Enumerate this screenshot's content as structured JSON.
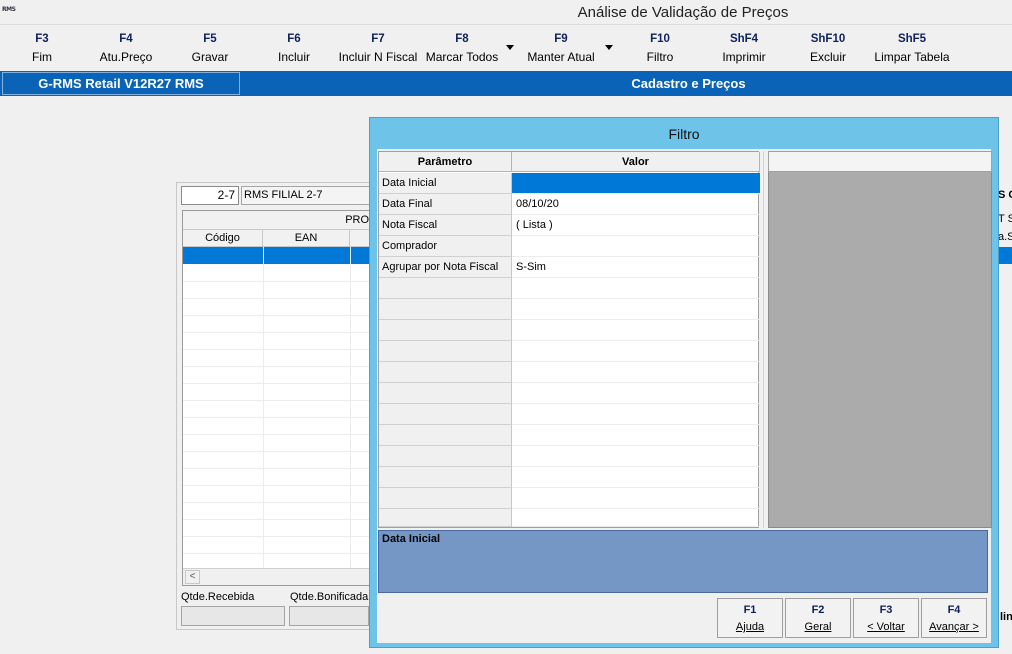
{
  "window": {
    "title": "Análise de Validação de Preços",
    "logo_text": "RMS"
  },
  "toolbar": [
    {
      "key": "F3",
      "label": "Fim"
    },
    {
      "key": "F4",
      "label": "Atu.Preço"
    },
    {
      "key": "F5",
      "label": "Gravar"
    },
    {
      "key": "F6",
      "label": "Incluir"
    },
    {
      "key": "F7",
      "label": "Incluir N Fiscal"
    },
    {
      "key": "F8",
      "label": "Marcar Todos"
    },
    {
      "key": "F9",
      "label": "Manter Atual"
    },
    {
      "key": "F10",
      "label": "Filtro"
    },
    {
      "key": "ShF4",
      "label": "Imprimir"
    },
    {
      "key": "ShF10",
      "label": "Excluir"
    },
    {
      "key": "ShF5",
      "label": "Limpar Tabela"
    }
  ],
  "header_bar": {
    "system": "G-RMS Retail V12R27 RMS",
    "module": "Cadastro e Preços"
  },
  "background_form": {
    "branch_code": "2-7",
    "branch_name": "RMS FILIAL 2-7",
    "group_header": "PROD",
    "columns": [
      "Código",
      "EAN"
    ],
    "qty_received_label": "Qtde.Recebida",
    "qty_bonus_label": "Qtde.Bonificada",
    "right_fragments": [
      "S C",
      "T S",
      "a.Su",
      "lin"
    ]
  },
  "filter_dialog": {
    "title": "Filtro",
    "headers": {
      "param": "Parâmetro",
      "value": "Valor"
    },
    "rows": [
      {
        "param": "Data Inicial",
        "value": ""
      },
      {
        "param": "Data Final",
        "value": "08/10/20"
      },
      {
        "param": "Nota Fiscal",
        "value": "( Lista )"
      },
      {
        "param": "Comprador",
        "value": ""
      },
      {
        "param": "Agrupar por Nota Fiscal",
        "value": "S-Sim"
      },
      {
        "param": "",
        "value": ""
      },
      {
        "param": "",
        "value": ""
      },
      {
        "param": "",
        "value": ""
      },
      {
        "param": "",
        "value": ""
      },
      {
        "param": "",
        "value": ""
      },
      {
        "param": "",
        "value": ""
      },
      {
        "param": "",
        "value": ""
      },
      {
        "param": "",
        "value": ""
      },
      {
        "param": "",
        "value": ""
      },
      {
        "param": "",
        "value": ""
      },
      {
        "param": "",
        "value": ""
      },
      {
        "param": "",
        "value": ""
      }
    ],
    "selected_index": 0,
    "description": "Data Inicial",
    "buttons": [
      {
        "key": "F1",
        "label": "Ajuda"
      },
      {
        "key": "F2",
        "label": "Geral"
      },
      {
        "key": "F3",
        "label": "< Voltar"
      },
      {
        "key": "F4",
        "label": "Avançar >"
      }
    ]
  },
  "colors": {
    "header_blue": "#0a63b6",
    "dialog_frame": "#6ec4e8",
    "selection": "#0078d7",
    "description_bg": "#7497c6"
  }
}
